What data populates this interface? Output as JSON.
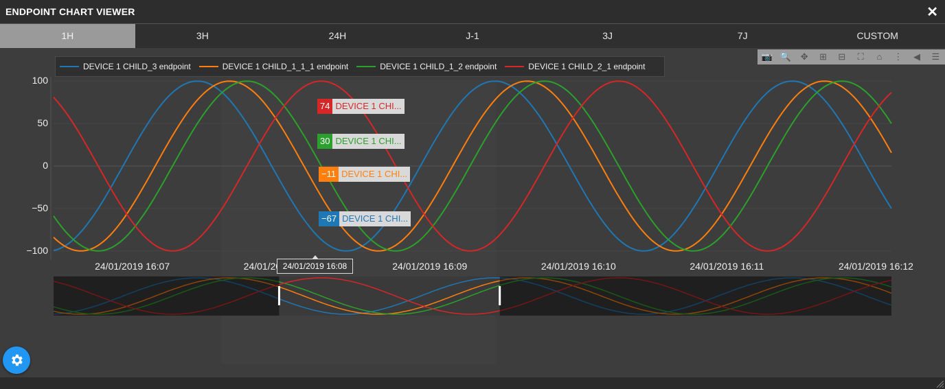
{
  "window": {
    "title": "ENDPOINT CHART VIEWER",
    "close_icon": "close-icon"
  },
  "tabs": [
    {
      "label": "1H",
      "active": true
    },
    {
      "label": "3H"
    },
    {
      "label": "24H"
    },
    {
      "label": "J-1"
    },
    {
      "label": "3J"
    },
    {
      "label": "7J"
    },
    {
      "label": "CUSTOM"
    }
  ],
  "modebar": [
    "camera-icon",
    "zoom-icon",
    "pan-icon",
    "zoom-in-icon",
    "zoom-out-icon",
    "autoscale-icon",
    "home-icon",
    "spike-lines-icon",
    "hover-closest-icon",
    "hover-compare-icon"
  ],
  "legend": [
    {
      "name": "DEVICE 1 CHILD_3 endpoint",
      "color": "#1f77b4"
    },
    {
      "name": "DEVICE 1 CHILD_1_1_1 endpoint",
      "color": "#ff7f0e"
    },
    {
      "name": "DEVICE 1 CHILD_1_2 endpoint",
      "color": "#2ca02c"
    },
    {
      "name": "DEVICE 1 CHILD_2_1 endpoint",
      "color": "#d62728"
    }
  ],
  "hover": {
    "x_label": "24/01/2019 16:08",
    "tips": [
      {
        "value": "74",
        "label": "DEVICE 1 CHI...",
        "color": "#d62728"
      },
      {
        "value": "30",
        "label": "DEVICE 1 CHI...",
        "color": "#2ca02c"
      },
      {
        "value": "−11",
        "label": "DEVICE 1 CHI...",
        "color": "#ff7f0e"
      },
      {
        "value": "−67",
        "label": "DEVICE 1 CHI...",
        "color": "#1f77b4"
      }
    ]
  },
  "chart_data": {
    "type": "line",
    "x_range": [
      "24/01/2019 16:06:27",
      "24/01/2019 16:12:05"
    ],
    "ylim": [
      -105,
      105
    ],
    "y_ticks": [
      "100",
      "50",
      "0",
      "−50",
      "−100"
    ],
    "y_tick_values": [
      100,
      50,
      0,
      -50,
      -100
    ],
    "x_ticks": [
      "24/01/2019 16:07",
      "24/01/2019 16:08",
      "24/01/2019 16:09",
      "24/01/2019 16:10",
      "24/01/2019 16:11",
      "24/01/2019 16:12"
    ],
    "period_seconds": 120,
    "series": [
      {
        "name": "DEVICE 1 CHILD_3 endpoint",
        "amplitude": 100,
        "peaks_at": "16:07:25",
        "color": "#1f77b4"
      },
      {
        "name": "DEVICE 1 CHILD_1_1_1 endpoint",
        "amplitude": 100,
        "peaks_at": "16:07:38",
        "color": "#ff7f0e"
      },
      {
        "name": "DEVICE 1 CHILD_1_2 endpoint",
        "amplitude": 100,
        "peaks_at": "16:07:45",
        "color": "#2ca02c"
      },
      {
        "name": "DEVICE 1 CHILD_2_1 endpoint",
        "amplitude": 100,
        "peaks_at": "16:08:15",
        "color": "#d62728"
      }
    ],
    "range_slider": {
      "selection": [
        "24/01/2019 16:07:58",
        "24/01/2019 16:09:27"
      ]
    },
    "grid": true,
    "legend_position": "top-left"
  },
  "settings": {
    "icon": "gear-icon"
  }
}
